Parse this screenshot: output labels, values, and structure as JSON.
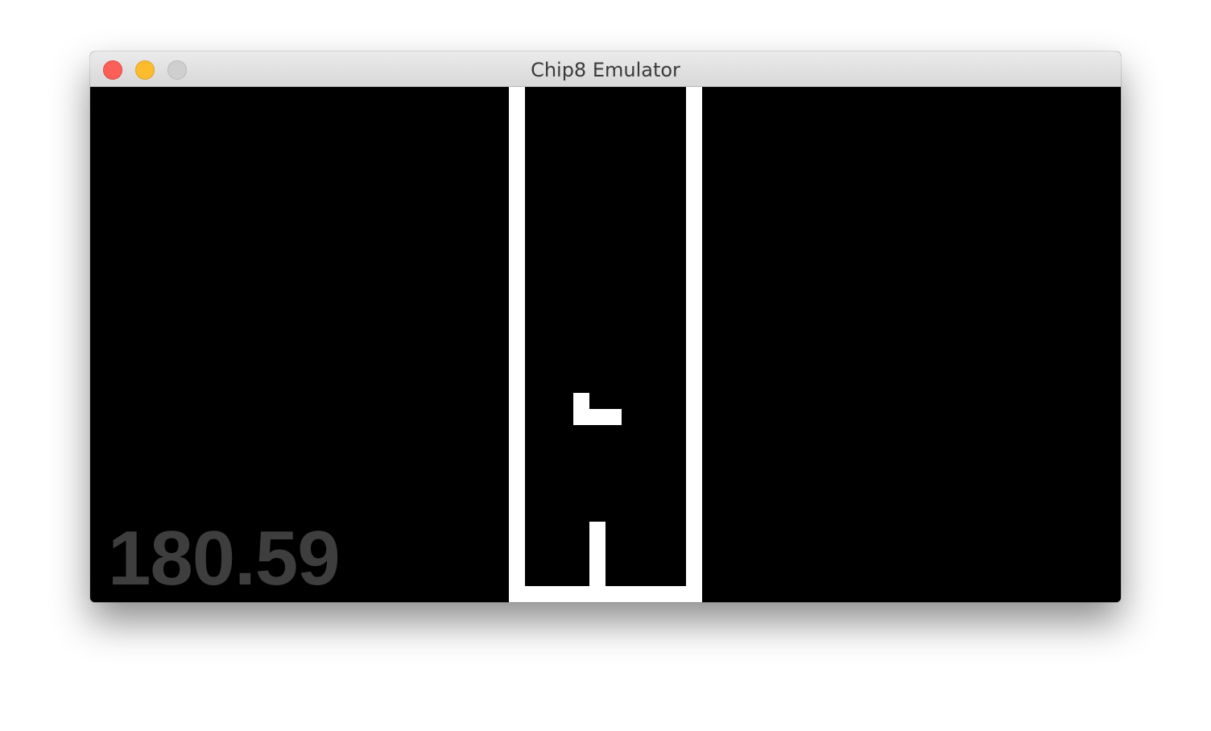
{
  "window": {
    "title": "Chip8 Emulator",
    "controls": {
      "close": "close",
      "minimize": "minimize",
      "zoom": "zoom"
    }
  },
  "emulator": {
    "fps_overlay": "180.59",
    "colors": {
      "background": "#000000",
      "foreground": "#ffffff",
      "overlay_text": "#3e3e3e"
    }
  }
}
